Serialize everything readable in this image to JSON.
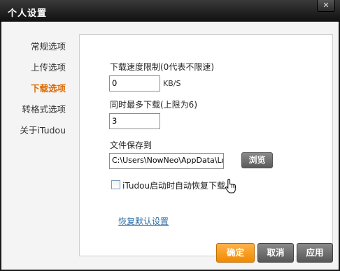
{
  "window": {
    "title": "个人设置",
    "close_glyph": "✕"
  },
  "nav": {
    "items": [
      {
        "label": "常规选项"
      },
      {
        "label": "上传选项"
      },
      {
        "label": "下载选项",
        "active": true
      },
      {
        "label": "转格式选项"
      },
      {
        "label": "关于iTudou"
      }
    ]
  },
  "download": {
    "speed_limit_label": "下载速度限制(0代表不限速)",
    "speed_limit_value": "0",
    "speed_unit": "KB/S",
    "max_downloads_label": "同时最多下载(上限为6)",
    "max_downloads_value": "3",
    "save_to_label": "文件保存到",
    "save_path_value": "C:\\Users\\NowNeo\\AppData\\Local",
    "browse_label": "浏览",
    "auto_resume_label": "iTudou启动时自动恢复下载",
    "auto_resume_checked": false,
    "restore_defaults_label": "恢复默认设置"
  },
  "footer": {
    "ok_label": "确定",
    "cancel_label": "取消",
    "apply_label": "应用"
  },
  "colors": {
    "accent": "#e06a00",
    "ok_button": "#f39200",
    "link": "#2e6fa8",
    "titlebar": "#1e1e1e"
  }
}
